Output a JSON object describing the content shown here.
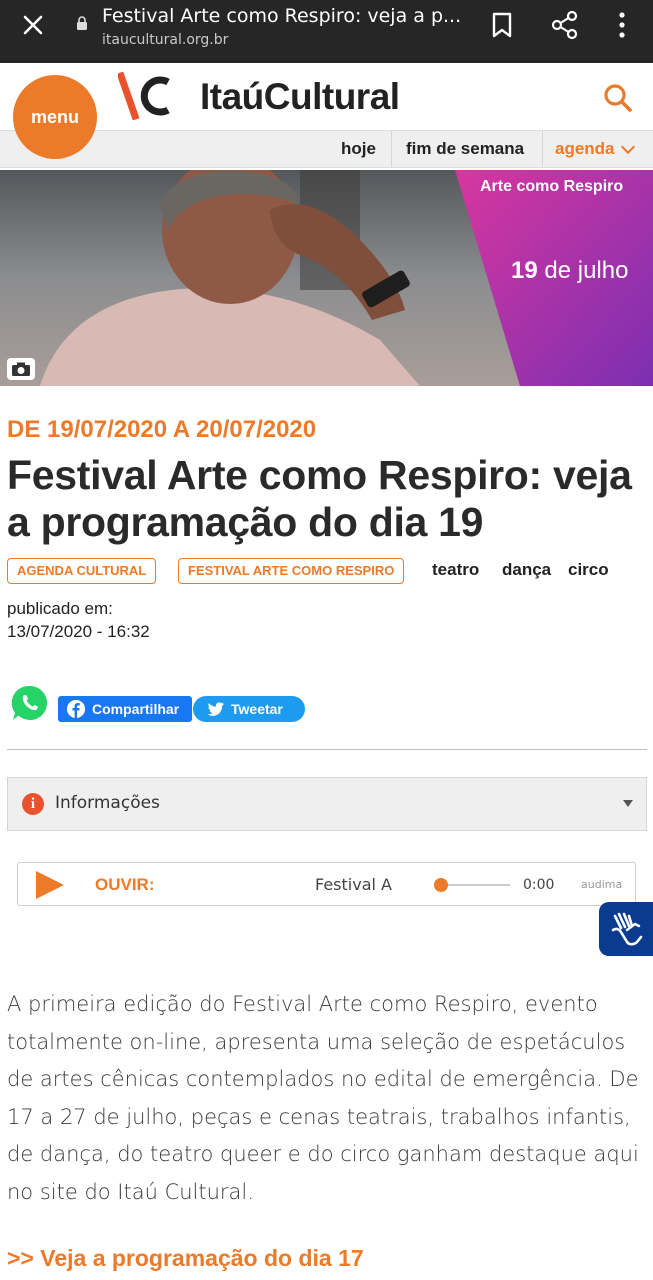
{
  "browser": {
    "page_title": "Festival Arte como Respiro: veja a p...",
    "url": "itaucultural.org.br"
  },
  "header": {
    "menu_label": "menu",
    "logo_text": "ItaúCultural",
    "brand_color": "#ec7a28"
  },
  "subnav": {
    "items": [
      {
        "label": "hoje"
      },
      {
        "label": "fim de semana"
      },
      {
        "label": "agenda"
      }
    ]
  },
  "hero": {
    "band_title": "Arte como Respiro",
    "band_date_day": "19",
    "band_date_rest": " de julho"
  },
  "article": {
    "date_range": "DE 19/07/2020 A 20/07/2020",
    "headline": "Festival Arte como Respiro: veja a programação do dia 19",
    "tags": [
      "AGENDA CULTURAL",
      "FESTIVAL ARTE COMO RESPIRO"
    ],
    "keywords": [
      "teatro",
      "dança",
      "circo"
    ],
    "published_label": "publicado em:",
    "published_date": "13/07/2020 - 16:32",
    "body": "A primeira edição do Festival Arte como Respiro, evento totalmente on-line, apresenta uma seleção de espetáculos de artes cênicas contemplados no edital de emergência. De 17 a 27 de julho, peças e cenas teatrais, trabalhos infantis, de dança, do teatro queer e do circo ganham destaque aqui no site do Itaú Cultural.",
    "link": ">> Veja a programação do dia 17"
  },
  "social": {
    "facebook_label": "Compartilhar",
    "twitter_label": "Tweetar"
  },
  "info": {
    "label": "Informações"
  },
  "player": {
    "ouvir_label": "OUVIR:",
    "track": "Festival A",
    "time": "0:00",
    "brand": "audima",
    "progress": 0
  }
}
